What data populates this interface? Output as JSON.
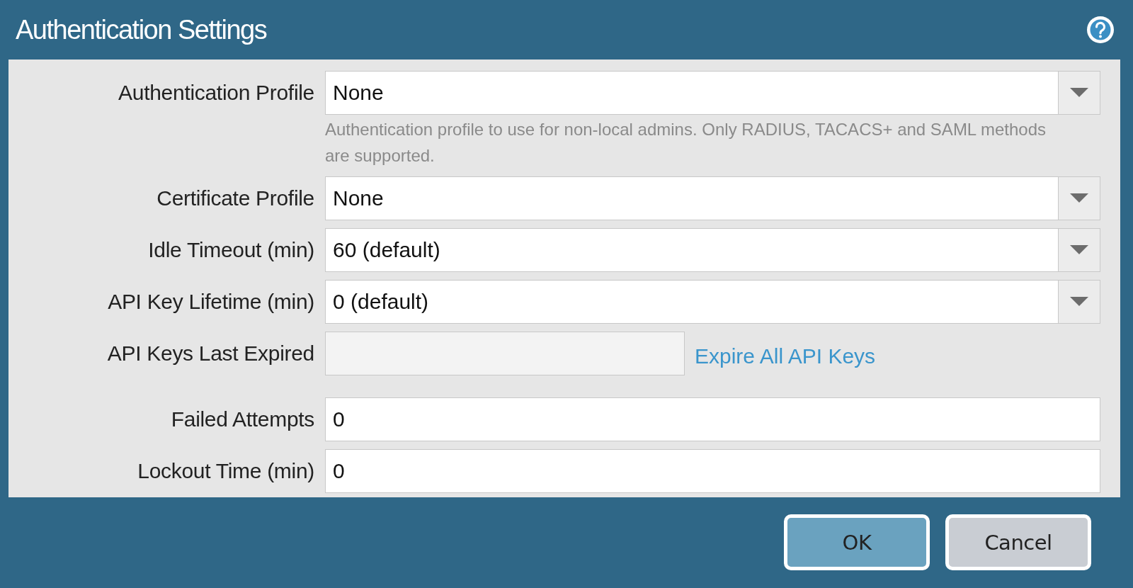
{
  "window": {
    "title": "Authentication Settings"
  },
  "fields": [
    {
      "kind": "dropdown",
      "label": "Authentication Profile",
      "value": "None",
      "help": "Authentication profile to use for non-local admins. Only RADIUS, TACACS+ and SAML methods are supported."
    },
    {
      "kind": "dropdown",
      "label": "Certificate Profile",
      "value": "None"
    },
    {
      "kind": "dropdown",
      "label": "Idle Timeout (min)",
      "value": "60 (default)"
    },
    {
      "kind": "dropdown",
      "label": "API Key Lifetime (min)",
      "value": "0 (default)"
    },
    {
      "kind": "readonly",
      "label": "API Keys Last Expired",
      "disabled": true,
      "link": "Expire All API Keys"
    },
    {
      "kind": "text",
      "label": "Failed Attempts",
      "value": "0"
    },
    {
      "kind": "text",
      "label": "Lockout Time (min)",
      "value": "0"
    }
  ],
  "buttons": [
    {
      "label": "OK",
      "kind": "primary"
    },
    {
      "label": "Cancel",
      "kind": "secondary"
    }
  ]
}
